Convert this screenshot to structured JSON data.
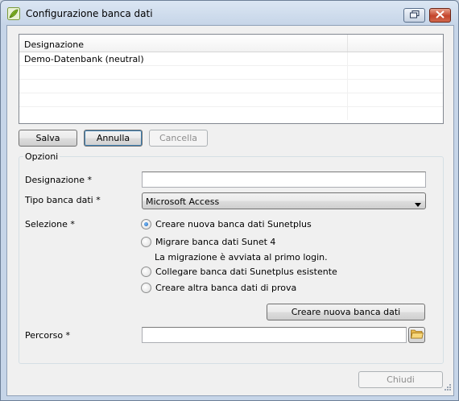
{
  "window": {
    "title": "Configurazione banca dati"
  },
  "grid": {
    "columns": [
      "Designazione",
      ""
    ],
    "rows": [
      {
        "designation": "Demo-Datenbank (neutral)"
      },
      {
        "designation": ""
      },
      {
        "designation": ""
      },
      {
        "designation": ""
      },
      {
        "designation": ""
      }
    ]
  },
  "grid_buttons": {
    "save": "Salva",
    "cancel": "Annulla",
    "delete": "Cancella"
  },
  "options": {
    "group_title": "Opzioni",
    "designation_label": "Designazione *",
    "designation_value": "",
    "db_type_label": "Tipo banca dati *",
    "db_type_value": "Microsoft Access",
    "selection_label": "Selezione *",
    "radios": [
      {
        "label": "Creare nuova banca dati Sunetplus",
        "checked": true
      },
      {
        "label": "Migrare banca dati Sunet 4",
        "checked": false,
        "note": "La migrazione è avviata al primo login."
      },
      {
        "label": "Collegare banca dati Sunetplus esistente",
        "checked": false
      },
      {
        "label": "Creare altra banca dati di prova",
        "checked": false
      }
    ],
    "create_button": "Creare nuova banca dati",
    "path_label": "Percorso *",
    "path_value": ""
  },
  "footer": {
    "close_button": "Chiudi"
  },
  "icons": {
    "app": "app-leaf-icon",
    "restore": "restore-icon",
    "close": "close-icon",
    "folder": "folder-icon",
    "dropdown": "chevron-down-icon"
  }
}
